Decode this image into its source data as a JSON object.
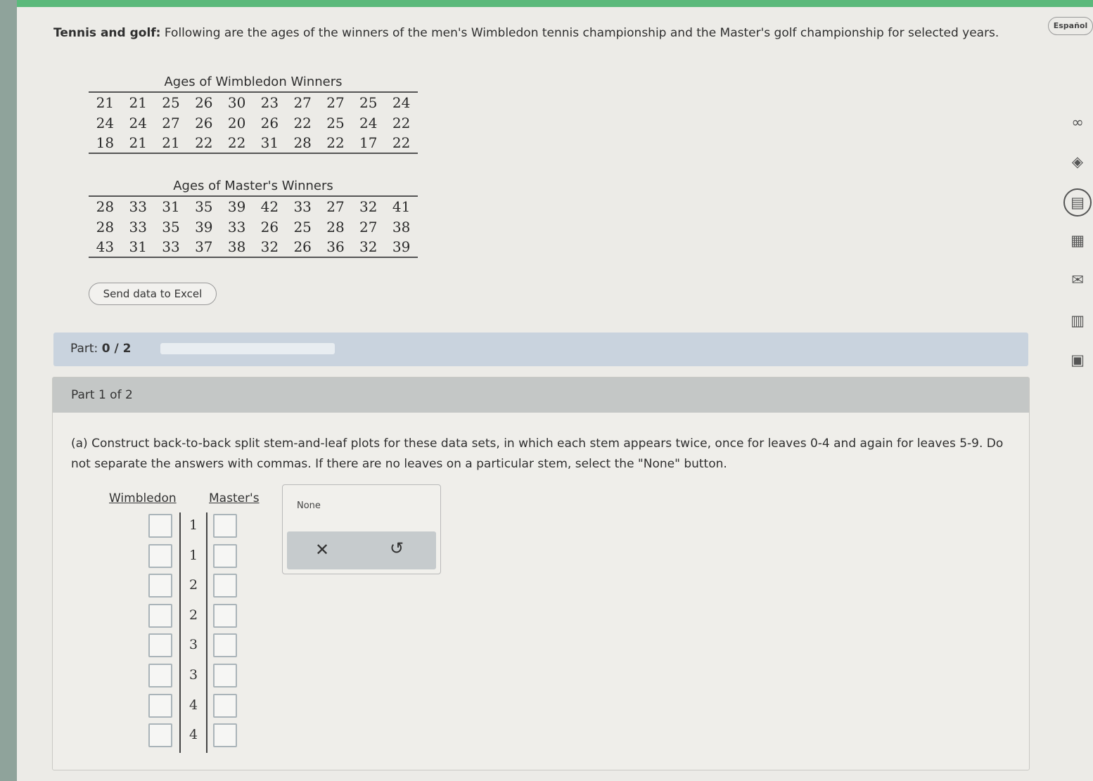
{
  "intro": {
    "title": "Tennis and golf:",
    "text": "Following are the ages of the winners of the men's Wimbledon tennis championship and the Master's golf championship for selected years."
  },
  "wimbledon_table": {
    "caption": "Ages of Wimbledon Winners",
    "rows": [
      [
        "21",
        "21",
        "25",
        "26",
        "30",
        "23",
        "27",
        "27",
        "25",
        "24"
      ],
      [
        "24",
        "24",
        "27",
        "26",
        "20",
        "26",
        "22",
        "25",
        "24",
        "22"
      ],
      [
        "18",
        "21",
        "21",
        "22",
        "22",
        "31",
        "28",
        "22",
        "17",
        "22"
      ]
    ]
  },
  "masters_table": {
    "caption": "Ages of Master's Winners",
    "rows": [
      [
        "28",
        "33",
        "31",
        "35",
        "39",
        "42",
        "33",
        "27",
        "32",
        "41"
      ],
      [
        "28",
        "33",
        "35",
        "39",
        "33",
        "26",
        "25",
        "28",
        "27",
        "38"
      ],
      [
        "43",
        "31",
        "33",
        "37",
        "38",
        "32",
        "26",
        "36",
        "32",
        "39"
      ]
    ]
  },
  "excel_button": "Send data to Excel",
  "part_bar": {
    "label": "Part:",
    "value": "0 / 2",
    "progress": 0
  },
  "question": {
    "header": "Part 1 of 2",
    "text": "(a) Construct back-to-back split stem-and-leaf plots for these data sets, in which each stem appears twice, once for leaves 0-4 and again for leaves 5-9. Do not separate the answers with commas. If there are no leaves on a particular stem, select the \"None\" button.",
    "left_heading": "Wimbledon",
    "right_heading": "Master's",
    "stems": [
      "1",
      "1",
      "2",
      "2",
      "3",
      "3",
      "4",
      "4"
    ]
  },
  "palette": {
    "none_label": "None",
    "clear_icon": "close-icon",
    "undo_icon": "undo-icon"
  },
  "language_button": "Español",
  "sidebar_icons": [
    "infinity-icon",
    "tag-icon",
    "ebook-icon",
    "calculator-icon",
    "mail-icon",
    "chart-icon",
    "worksheet-icon"
  ]
}
